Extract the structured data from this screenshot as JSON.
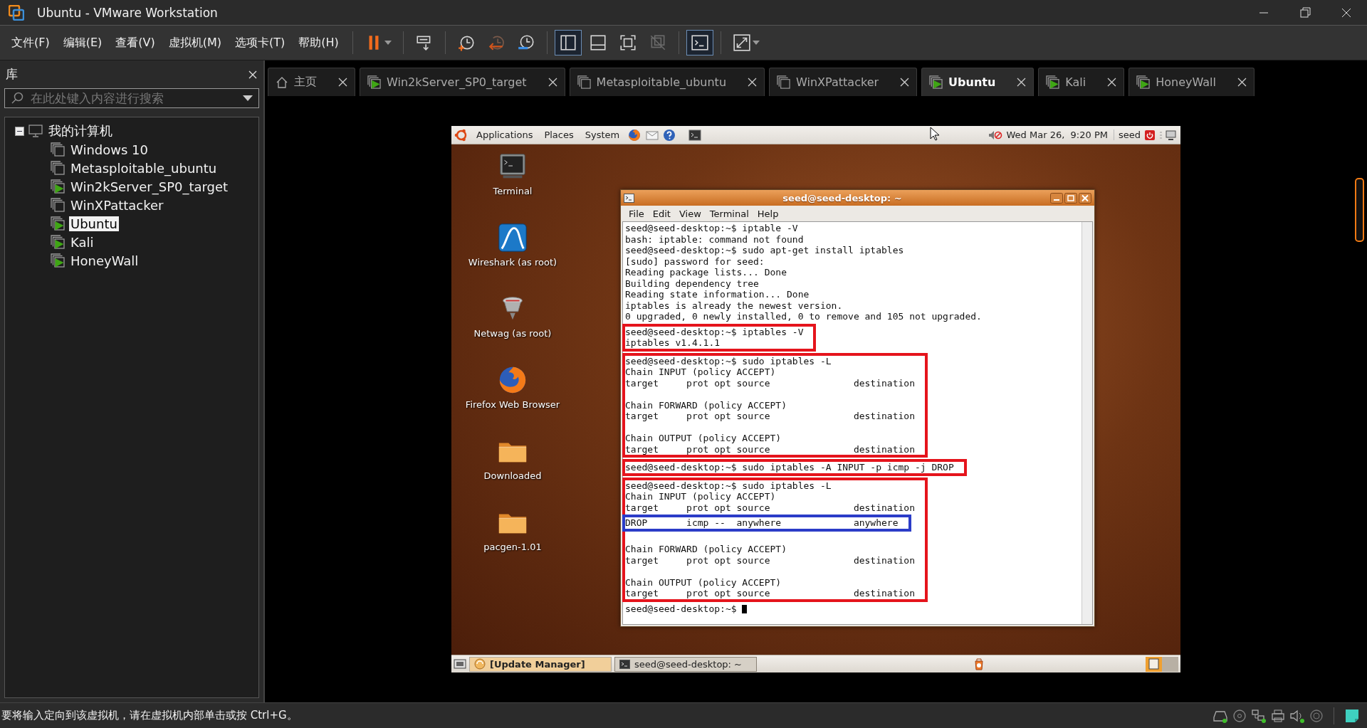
{
  "window": {
    "title": "Ubuntu - VMware Workstation"
  },
  "menu": [
    "文件(F)",
    "编辑(E)",
    "查看(V)",
    "虚拟机(M)",
    "选项卡(T)",
    "帮助(H)"
  ],
  "toolbar": [
    [
      {
        "kind": "pause",
        "selected": false
      }
    ],
    [
      {
        "kind": "send-keys",
        "selected": false
      }
    ],
    [
      {
        "kind": "snapshot",
        "selected": false
      },
      {
        "kind": "revert",
        "selected": false
      },
      {
        "kind": "snapshot-manager",
        "selected": false
      }
    ],
    [
      {
        "kind": "library-view",
        "selected": true
      },
      {
        "kind": "thumbnail-view",
        "selected": false
      },
      {
        "kind": "fullscreen",
        "selected": false
      },
      {
        "kind": "unity",
        "selected": false
      }
    ],
    [
      {
        "kind": "console",
        "selected": true
      }
    ],
    [
      {
        "kind": "stretch",
        "selected": false
      }
    ]
  ],
  "library": {
    "title": "库",
    "search": {
      "placeholder": "在此处键入内容进行搜索"
    },
    "tree": {
      "label": "我的计算机",
      "expanded": true,
      "children": [
        {
          "label": "Windows 10",
          "running": false,
          "selected": false
        },
        {
          "label": "Metasploitable_ubuntu",
          "running": false,
          "selected": false
        },
        {
          "label": "Win2kServer_SP0_target",
          "running": true,
          "selected": false
        },
        {
          "label": "WinXPattacker",
          "running": false,
          "selected": false
        },
        {
          "label": "Ubuntu",
          "running": true,
          "selected": true
        },
        {
          "label": "Kali",
          "running": true,
          "selected": false
        },
        {
          "label": "HoneyWall",
          "running": true,
          "selected": false
        }
      ]
    }
  },
  "tabs": [
    {
      "kind": "home",
      "label": "主页",
      "selected": false
    },
    {
      "kind": "vm",
      "label": "Win2kServer_SP0_target",
      "running": true,
      "selected": false
    },
    {
      "kind": "vm",
      "label": "Metasploitable_ubuntu",
      "running": false,
      "selected": false
    },
    {
      "kind": "vm",
      "label": "WinXPattacker",
      "running": false,
      "selected": false
    },
    {
      "kind": "vm",
      "label": "Ubuntu",
      "running": true,
      "selected": true
    },
    {
      "kind": "vm",
      "label": "Kali",
      "running": true,
      "selected": false
    },
    {
      "kind": "vm",
      "label": "HoneyWall",
      "running": true,
      "selected": false
    }
  ],
  "guest": {
    "top_panel": {
      "menus": [
        "Applications",
        "Places",
        "System"
      ],
      "clock": "Wed Mar 26,  9:20 PM",
      "user": "seed"
    },
    "desktop_icons": [
      {
        "kind": "terminal",
        "label": "Terminal"
      },
      {
        "kind": "wireshark",
        "label": "Wireshark (as root)"
      },
      {
        "kind": "netwag",
        "label": "Netwag (as root)"
      },
      {
        "kind": "firefox",
        "label": "Firefox Web Browser"
      },
      {
        "kind": "folder",
        "label": "Downloaded"
      },
      {
        "kind": "folder",
        "label": "pacgen-1.01"
      }
    ],
    "terminal": {
      "title": "seed@seed-desktop: ~",
      "menu": [
        "File",
        "Edit",
        "View",
        "Terminal",
        "Help"
      ],
      "output": [
        {
          "kind": "plain",
          "lines": [
            "seed@seed-desktop:~$ iptable -V",
            "bash: iptable: command not found",
            "seed@seed-desktop:~$ sudo apt-get install iptables",
            "[sudo] password for seed:",
            "Reading package lists... Done",
            "Building dependency tree",
            "Reading state information... Done",
            "iptables is already the newest version.",
            "0 upgraded, 0 newly installed, 0 to remove and 105 not upgraded."
          ]
        },
        {
          "kind": "framed",
          "color": "#e5141c",
          "children": [
            {
              "kind": "plain",
              "lines": [
                "seed@seed-desktop:~$ iptables -V",
                "iptables v1.4.1.1"
              ]
            }
          ]
        },
        {
          "kind": "framed",
          "color": "#e5141c",
          "children": [
            {
              "kind": "plain",
              "lines": [
                "seed@seed-desktop:~$ sudo iptables -L",
                "Chain INPUT (policy ACCEPT)",
                "target     prot opt source               destination"
              ]
            },
            {
              "kind": "blank"
            },
            {
              "kind": "plain",
              "lines": [
                "Chain FORWARD (policy ACCEPT)",
                "target     prot opt source               destination"
              ]
            },
            {
              "kind": "blank"
            },
            {
              "kind": "plain",
              "lines": [
                "Chain OUTPUT (policy ACCEPT)",
                "target     prot opt source               destination"
              ]
            }
          ]
        },
        {
          "kind": "framed",
          "color": "#e5141c",
          "children": [
            {
              "kind": "plain",
              "lines": [
                "seed@seed-desktop:~$ sudo iptables -A INPUT -p icmp -j DROP"
              ]
            }
          ]
        },
        {
          "kind": "framed",
          "color": "#e5141c",
          "children": [
            {
              "kind": "plain",
              "lines": [
                "seed@seed-desktop:~$ sudo iptables -L",
                "Chain INPUT (policy ACCEPT)",
                "target     prot opt source               destination"
              ]
            },
            {
              "kind": "framed",
              "color": "#2b3cc8",
              "children": [
                {
                  "kind": "plain",
                  "lines": [
                    "DROP       icmp --  anywhere             anywhere"
                  ]
                }
              ]
            },
            {
              "kind": "blank"
            },
            {
              "kind": "plain",
              "lines": [
                "Chain FORWARD (policy ACCEPT)",
                "target     prot opt source               destination"
              ]
            },
            {
              "kind": "blank"
            },
            {
              "kind": "plain",
              "lines": [
                "Chain OUTPUT (policy ACCEPT)",
                "target     prot opt source               destination"
              ]
            }
          ]
        },
        {
          "kind": "prompt",
          "lines": [
            "seed@seed-desktop:~$ "
          ]
        }
      ]
    },
    "taskbar": [
      {
        "kind": "update",
        "label": "[Update Manager]",
        "selected": false
      },
      {
        "kind": "terminal",
        "label": "seed@seed-desktop: ~",
        "selected": true
      }
    ]
  },
  "status_bar": {
    "message": "要将输入定向到该虚拟机，请在虚拟机内部单击或按 Ctrl+G。"
  }
}
